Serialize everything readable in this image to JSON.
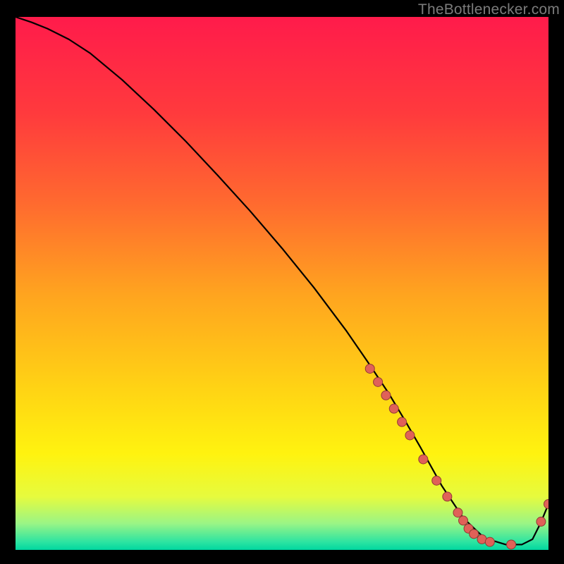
{
  "attribution": "TheBottlenecker.com",
  "chart_data": {
    "type": "line",
    "title": "",
    "xlabel": "",
    "ylabel": "",
    "xlim": [
      0,
      100
    ],
    "ylim": [
      0,
      100
    ],
    "grid": false,
    "curve": {
      "x": [
        0,
        3,
        6,
        10,
        14,
        20,
        26,
        32,
        38,
        44,
        50,
        56,
        62,
        66,
        70,
        73,
        76,
        80,
        84,
        88,
        92,
        95,
        97,
        98.5,
        100
      ],
      "y": [
        100,
        99,
        97.8,
        95.8,
        93.2,
        88.2,
        82.6,
        76.6,
        70.2,
        63.6,
        56.6,
        49.2,
        41.2,
        35.4,
        29.4,
        24.4,
        19.2,
        12.0,
        6.0,
        2.2,
        1.0,
        1.0,
        2.0,
        5.0,
        8.6
      ]
    },
    "scatter_points": [
      {
        "x": 66.5,
        "y": 34.0
      },
      {
        "x": 68.0,
        "y": 31.5
      },
      {
        "x": 69.5,
        "y": 29.0
      },
      {
        "x": 71.0,
        "y": 26.5
      },
      {
        "x": 72.5,
        "y": 24.0
      },
      {
        "x": 74.0,
        "y": 21.5
      },
      {
        "x": 76.5,
        "y": 17.0
      },
      {
        "x": 79.0,
        "y": 13.0
      },
      {
        "x": 81.0,
        "y": 10.0
      },
      {
        "x": 83.0,
        "y": 7.0
      },
      {
        "x": 84.0,
        "y": 5.5
      },
      {
        "x": 85.0,
        "y": 4.0
      },
      {
        "x": 86.0,
        "y": 3.0
      },
      {
        "x": 87.5,
        "y": 2.0
      },
      {
        "x": 89.0,
        "y": 1.5
      },
      {
        "x": 93.0,
        "y": 1.0
      },
      {
        "x": 98.6,
        "y": 5.3
      },
      {
        "x": 100.0,
        "y": 8.6
      }
    ],
    "point_marker": {
      "radius_px": 6.5,
      "fill": "#e06158",
      "stroke": "#913b34",
      "stroke_width": 1
    },
    "background_gradient": {
      "stops": [
        {
          "offset": 0.0,
          "color": "#ff1b4b"
        },
        {
          "offset": 0.18,
          "color": "#ff3a3d"
        },
        {
          "offset": 0.35,
          "color": "#ff6a2f"
        },
        {
          "offset": 0.52,
          "color": "#ffa41f"
        },
        {
          "offset": 0.7,
          "color": "#ffd414"
        },
        {
          "offset": 0.82,
          "color": "#fff30f"
        },
        {
          "offset": 0.9,
          "color": "#e6fb3e"
        },
        {
          "offset": 0.95,
          "color": "#9bf585"
        },
        {
          "offset": 0.985,
          "color": "#2de4a1"
        },
        {
          "offset": 1.0,
          "color": "#00d7a0"
        }
      ]
    }
  }
}
